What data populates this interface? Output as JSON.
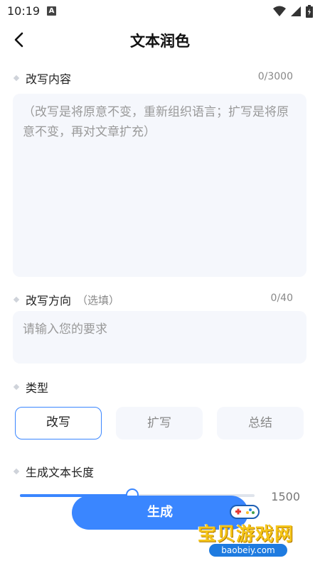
{
  "status_bar": {
    "time": "10:19",
    "a_icon": "A",
    "icons": [
      "wifi-icon",
      "signal-icon",
      "battery-icon"
    ]
  },
  "header": {
    "title": "文本润色",
    "back_icon": "chevron-left-icon"
  },
  "content_section": {
    "label": "改写内容",
    "counter": "0/3000",
    "placeholder": "（改写是将原意不变，重新组织语言；扩写是将原意不变，再对文章扩充）"
  },
  "direction_section": {
    "label": "改写方向",
    "hint": "（选填）",
    "counter": "0/40",
    "placeholder": "请输入您的要求"
  },
  "type_section": {
    "label": "类型",
    "options": [
      {
        "label": "改写",
        "selected": true
      },
      {
        "label": "扩写",
        "selected": false
      },
      {
        "label": "总结",
        "selected": false
      }
    ]
  },
  "length_section": {
    "label": "生成文本长度",
    "value": "1500",
    "slider_fraction": 0.48
  },
  "generate_button": {
    "label": "生成"
  },
  "watermark": {
    "title": "宝贝游戏网",
    "url": "baobeiy.com"
  },
  "colors": {
    "accent": "#3a86ff",
    "field_bg": "#f5f7fc",
    "muted": "#888888"
  }
}
